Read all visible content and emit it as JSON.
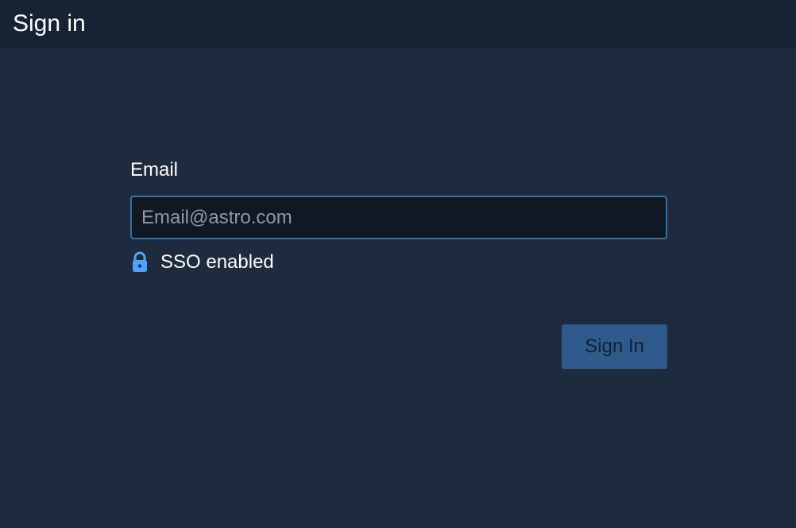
{
  "header": {
    "title": "Sign in"
  },
  "form": {
    "email_label": "Email",
    "email_value": "",
    "email_placeholder": "Email@astro.com",
    "sso": {
      "icon": "lock-icon",
      "text": "SSO enabled"
    },
    "submit_label": "Sign In"
  },
  "colors": {
    "background": "#1e2b3e",
    "header_background": "#172334",
    "input_background": "#101823",
    "input_border": "#3a6fa3",
    "lock_icon": "#4da3ff",
    "button_background": "#2e5b8c",
    "button_text": "#12202f"
  }
}
